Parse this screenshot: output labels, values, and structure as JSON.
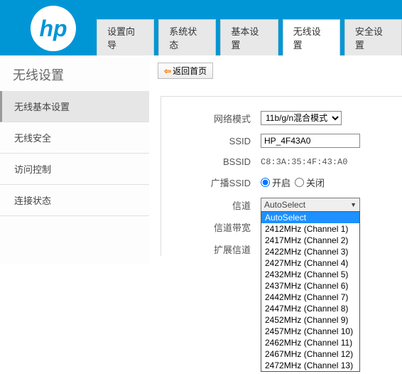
{
  "header": {
    "logo_alt": "HP",
    "tabs": [
      {
        "label": "设置向导",
        "active": false
      },
      {
        "label": "系统状态",
        "active": false
      },
      {
        "label": "基本设置",
        "active": false
      },
      {
        "label": "无线设置",
        "active": true
      },
      {
        "label": "安全设置",
        "active": false
      }
    ]
  },
  "sidebar": {
    "title": "无线设置",
    "items": [
      {
        "label": "无线基本设置",
        "active": true
      },
      {
        "label": "无线安全",
        "active": false
      },
      {
        "label": "访问控制",
        "active": false
      },
      {
        "label": "连接状态",
        "active": false
      }
    ]
  },
  "back_button": {
    "arrow": "⇦",
    "label": "返回首页"
  },
  "form": {
    "network_mode": {
      "label": "网络模式",
      "value": "11b/g/n混合模式"
    },
    "ssid": {
      "label": "SSID",
      "value": "HP_4F43A0"
    },
    "bssid": {
      "label": "BSSID",
      "value": "C8:3A:35:4F:43:A0"
    },
    "broadcast": {
      "label": "广播SSID",
      "on": "开启",
      "off": "关闭",
      "value": "on"
    },
    "channel": {
      "label": "信道",
      "value": "AutoSelect",
      "options": [
        "AutoSelect",
        "2412MHz (Channel 1)",
        "2417MHz (Channel 2)",
        "2422MHz (Channel 3)",
        "2427MHz (Channel 4)",
        "2432MHz (Channel 5)",
        "2437MHz (Channel 6)",
        "2442MHz (Channel 7)",
        "2447MHz (Channel 8)",
        "2452MHz (Channel 9)",
        "2457MHz (Channel 10)",
        "2462MHz (Channel 11)",
        "2467MHz (Channel 12)",
        "2472MHz (Channel 13)"
      ]
    },
    "bandwidth": {
      "label": "信道带宽"
    },
    "ext_channel": {
      "label": "扩展信道"
    }
  }
}
